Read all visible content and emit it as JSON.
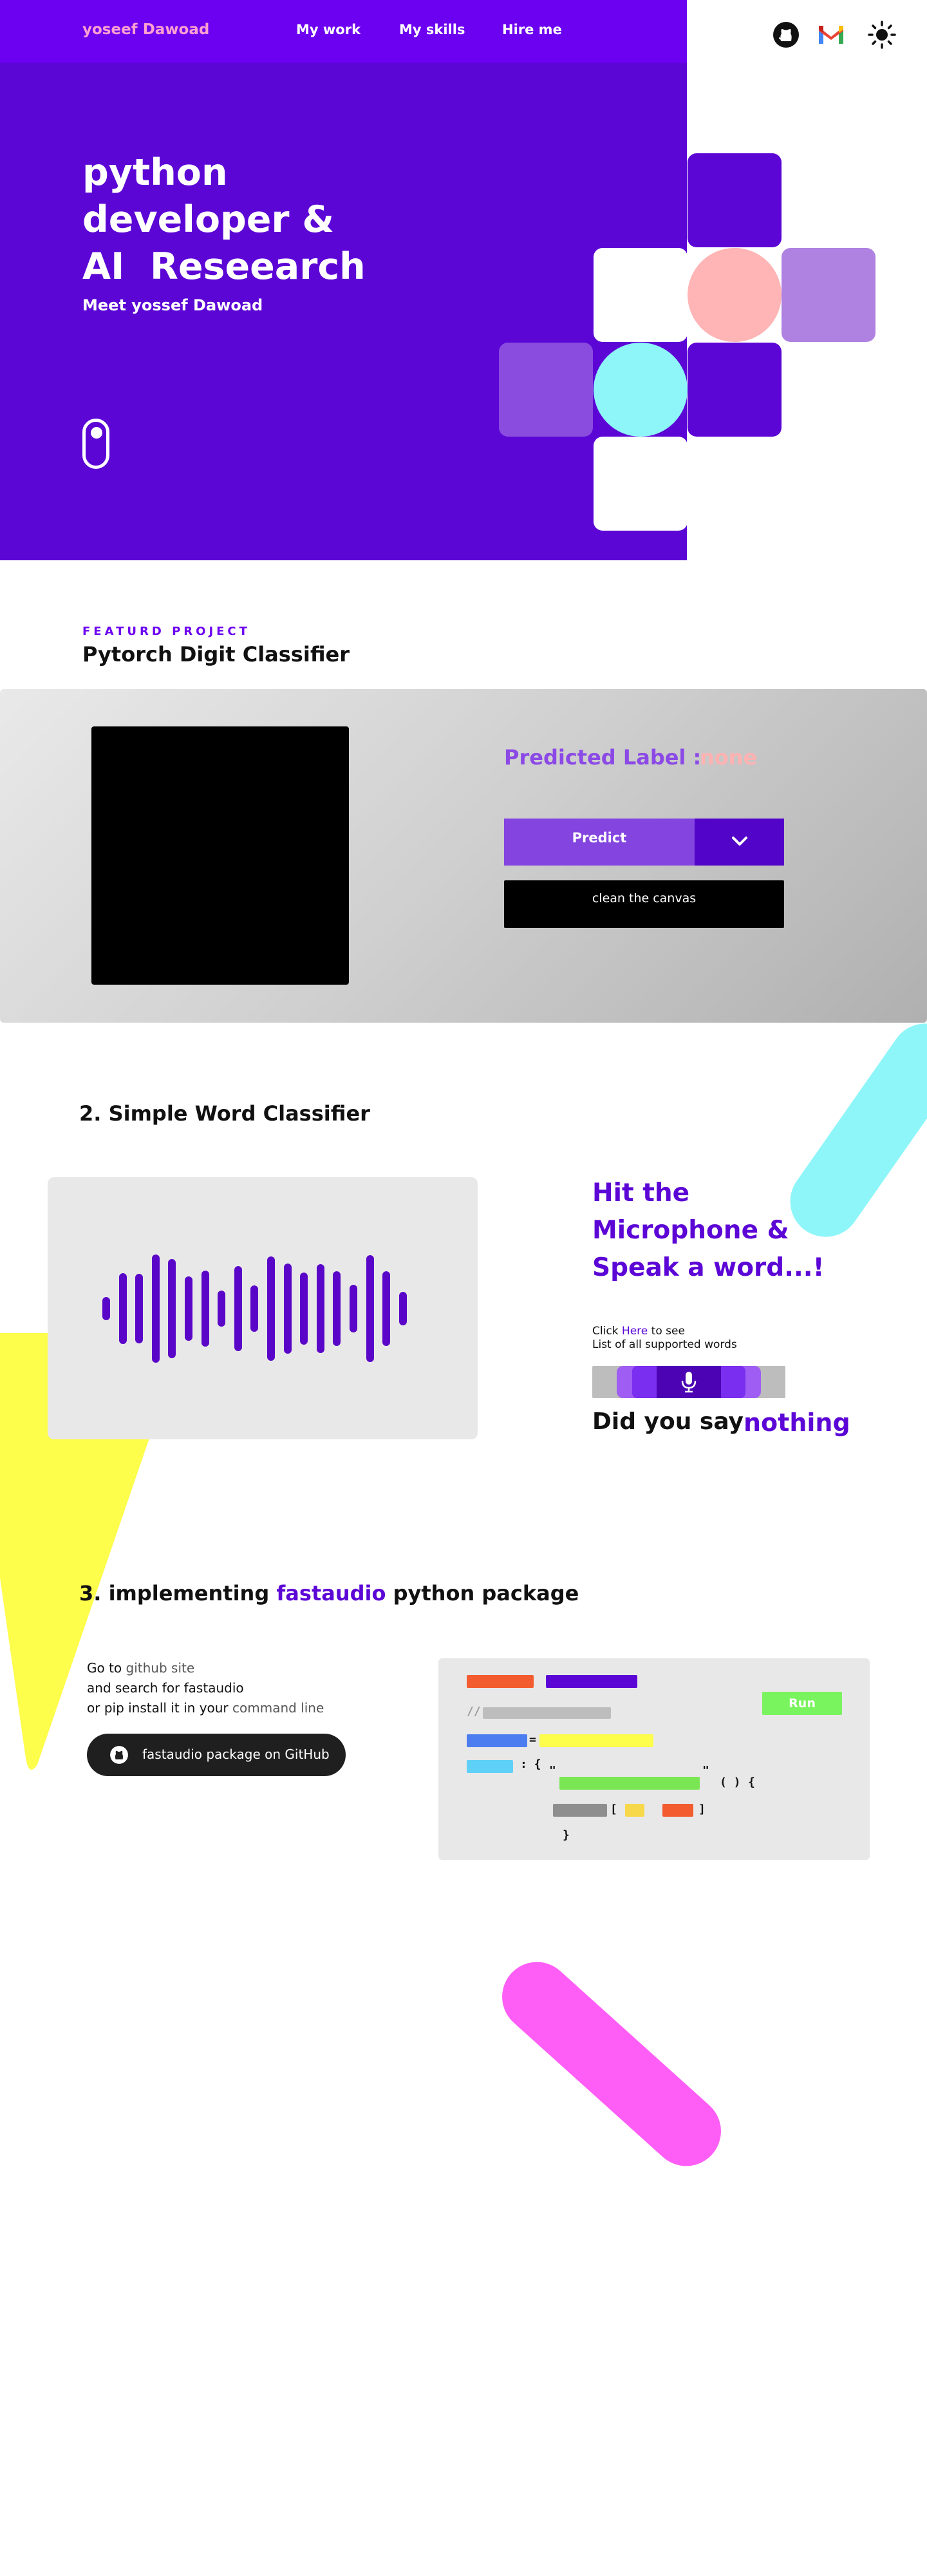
{
  "header": {
    "brand": "yoseef Dawoad",
    "nav": [
      {
        "label": "My work"
      },
      {
        "label": "My skills"
      },
      {
        "label": "Hire me"
      }
    ],
    "icons": [
      "github-icon",
      "gmail-icon",
      "sun-icon"
    ]
  },
  "hero": {
    "title_line1": "python",
    "title_line2": "developer &",
    "title_line3": "AI  Reseearch",
    "subtitle": "Meet yossef Dawoad"
  },
  "featured": {
    "kicker": "FEATURD PROJECT",
    "title": "Pytorch Digit Classifier",
    "predicted_label": "Predicted Label :",
    "predicted_value": "none",
    "predict_button": "Predict",
    "clean_button": "clean the canvas"
  },
  "word_classifier": {
    "title": "2. Simple Word Classifier",
    "heading_line1": "Hit the",
    "heading_line2": "Microphone &",
    "heading_line3": "Speak a word...!",
    "click_prefix": "Click ",
    "click_link": "Here",
    "click_suffix": " to see",
    "supported_text": "List of all supported words",
    "did_you_say": "Did you say",
    "did_you_say_value": "nothing"
  },
  "fastaudio": {
    "title_prefix": "3. implementing ",
    "title_highlight": "fastaudio",
    "title_suffix": " python package",
    "line1_prefix": "Go to ",
    "line1_muted": "github site",
    "line2": "and search for fastaudio",
    "line3_prefix": "or pip install it in your ",
    "line3_muted": "command line",
    "github_button": "fastaudio package on GitHub",
    "run_button": "Run",
    "code_tokens": {
      "comment": "//",
      "equals": "=",
      "colon_brace": ": {",
      "open_quote": "\"",
      "close_quote": "\"",
      "parens": "( )",
      "brace_open": "{",
      "bracket_open": "[",
      "bracket_close": "]",
      "brace_close": "}"
    }
  },
  "colors": {
    "hero_purple": "#5c06d6",
    "topbar_purple": "#6c00f0",
    "brand_pink": "#ff9fd2",
    "accent_purple": "#8444e0",
    "cyan": "#8ef6f8",
    "yellow": "#fdfd4c",
    "magenta": "#ff5ef6",
    "run_green": "#7af45e"
  }
}
